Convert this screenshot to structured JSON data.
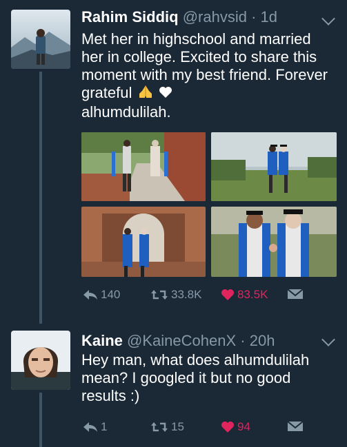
{
  "tweets": [
    {
      "name": "Rahim Siddiq",
      "handle": "@rahvsid",
      "time": "· 1d",
      "text_main": "Met her in highschool and married her in college. Excited to share this moment with my best friend. Forever grateful",
      "text_end": "alhumdulilah.",
      "icons": [
        "praying-hands-emoji",
        "white-heart-emoji"
      ],
      "actions": {
        "replies": "140",
        "retweets": "33.8K",
        "likes": "83.5K"
      }
    },
    {
      "name": "Kaine",
      "handle": "@KaineCohenX",
      "time": "· 20h",
      "text": "Hey man, what does alhumdulilah mean? I googled it but no good results :)",
      "actions": {
        "replies": "1",
        "retweets": "15",
        "likes": "94"
      }
    }
  ],
  "colors": {
    "background": "#1b2836",
    "muted": "#8899a6",
    "like": "#e0245e",
    "thread": "#3d5466"
  }
}
